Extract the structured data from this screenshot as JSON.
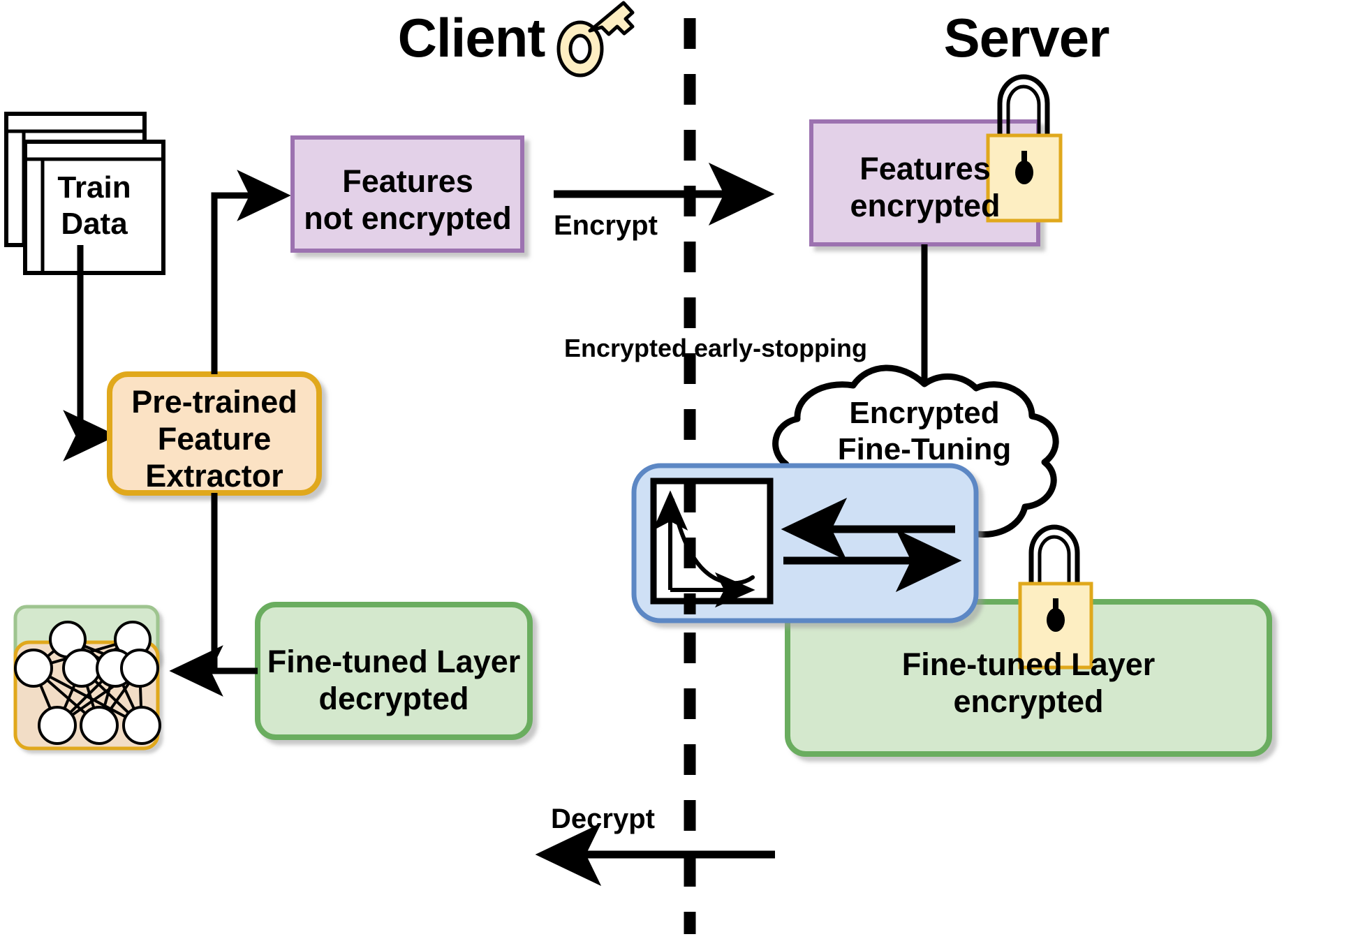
{
  "diagram": {
    "title_client": "Client",
    "title_server": "Server",
    "divider": "vertical-dashed-boundary"
  },
  "client": {
    "train_data": {
      "label": "Train\nData",
      "icon": "stacked-documents-icon"
    },
    "feature_extractor": {
      "label": "Pre-trained\nFeature\nExtractor",
      "fill": "#fbe2c4",
      "stroke": "#e0a81c"
    },
    "features_plain": {
      "label": "Features\nnot encrypted",
      "fill": "#e3d1e8",
      "stroke": "#9c72b0"
    },
    "fine_tuned_decrypted": {
      "label": "Fine-tuned Layer\ndecrypted",
      "fill": "#d4e8cd",
      "stroke": "#6aad5f"
    },
    "network_icon": {
      "name": "neural-network-icon",
      "top_layer_nodes": 2,
      "middle_layer_nodes": 4,
      "bottom_layer_nodes": 3,
      "top_band_fill": "#d4e8cd",
      "top_band_stroke": "#9ec48f",
      "body_fill": "#f2ddc6",
      "body_stroke": "#e0a81c"
    },
    "key_icon": "key-icon"
  },
  "server": {
    "features_encrypted": {
      "label": "Features\nencrypted",
      "fill": "#e3d1e8",
      "stroke": "#9c72b0"
    },
    "fine_tuning_cloud": {
      "label": "Encrypted\nFine-Tuning",
      "shape": "cloud"
    },
    "fine_tuned_encrypted": {
      "label": "Fine-tuned Layer\nencrypted",
      "fill": "#d4e8cd",
      "stroke": "#6aad5f"
    },
    "lock_icon_top": "padlock-icon",
    "lock_icon_bottom": "padlock-icon",
    "lock_fill": "#fdeec2",
    "lock_stroke": "#e0a81c"
  },
  "middle": {
    "early_stopping_caption": "Encrypted early-stopping",
    "early_stopping_box": {
      "fill": "#cfe0f5",
      "stroke": "#5b87c4"
    },
    "loss_chart_icon": "loss-curve-icon",
    "arrow_left_icon": "arrow-left-icon",
    "arrow_right_icon": "arrow-right-icon"
  },
  "flows": {
    "encrypt_label": "Encrypt",
    "decrypt_label": "Decrypt"
  },
  "chart_data": {
    "type": "line",
    "title": "",
    "xlabel": "",
    "ylabel": "",
    "x": [
      0,
      1,
      2,
      3,
      4,
      5,
      6,
      7,
      8
    ],
    "values": [
      1.0,
      0.62,
      0.4,
      0.27,
      0.19,
      0.14,
      0.11,
      0.1,
      0.11
    ],
    "xlim": [
      0,
      8
    ],
    "ylim": [
      0,
      1
    ],
    "grid": false,
    "legend": "none",
    "annotations": [
      "decaying loss curve inside early-stopping icon"
    ]
  }
}
